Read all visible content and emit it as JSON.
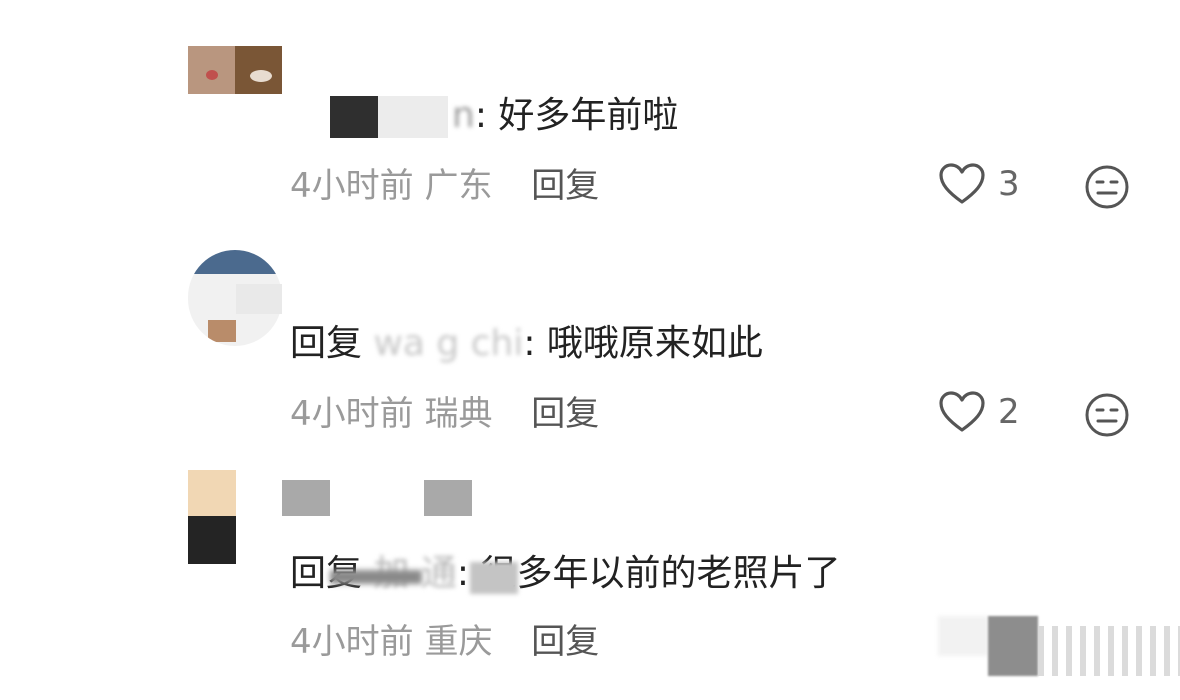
{
  "comments": [
    {
      "author_tail": "n",
      "text": ": 好多年前啦",
      "time": "4小时前",
      "location": "广东",
      "reply_label": "回复",
      "likes": "3"
    },
    {
      "reply_prefix": "回复",
      "reply_to": "wa g chi",
      "text": ": 哦哦原来如此",
      "time": "4小时前",
      "location": "瑞典",
      "reply_label": "回复",
      "likes": "2"
    },
    {
      "reply_prefix": "回复",
      "reply_to": "加  通",
      "text": ": 很多年以前的老照片了",
      "time": "4小时前",
      "location": "重庆",
      "reply_label": "回复"
    }
  ],
  "icons": {
    "like": "heart-outline-icon",
    "reaction": "neutral-face-icon"
  },
  "colors": {
    "text": "#222222",
    "meta": "#9a9a9a",
    "icon": "#555555"
  }
}
